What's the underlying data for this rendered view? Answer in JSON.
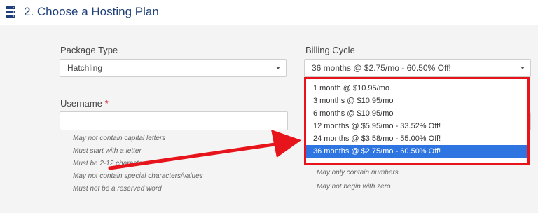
{
  "header": {
    "icon": "server-stack-icon",
    "title": "2. Choose a Hosting Plan"
  },
  "package_type": {
    "label": "Package Type",
    "value": "Hatchling"
  },
  "billing_cycle": {
    "label": "Billing Cycle",
    "value": "36 months @ $2.75/mo - 60.50% Off!",
    "options": [
      "1 month @ $10.95/mo",
      "3 months @ $10.95/mo",
      "6 months @ $10.95/mo",
      "12 months @ $5.95/mo - 33.52% Off!",
      "24 months @ $3.58/mo - 55.00% Off!",
      "36 months @ $2.75/mo - 60.50% Off!"
    ],
    "selected_option": "36 months @ $2.75/mo - 60.50% Off!"
  },
  "username": {
    "label": "Username",
    "required_mark": "*",
    "value": "",
    "rules": [
      "May not contain capital letters",
      "Must start with a letter",
      "Must be 2-12 characters l",
      "May not contain special characters/values",
      "Must not be a reserved word"
    ]
  },
  "pin_rules": [
    "May only contain numbers",
    "May not begin with zero"
  ],
  "colors": {
    "accent": "#1e3f7a",
    "highlight": "#2f75e1",
    "annotation": "#e8141b"
  }
}
